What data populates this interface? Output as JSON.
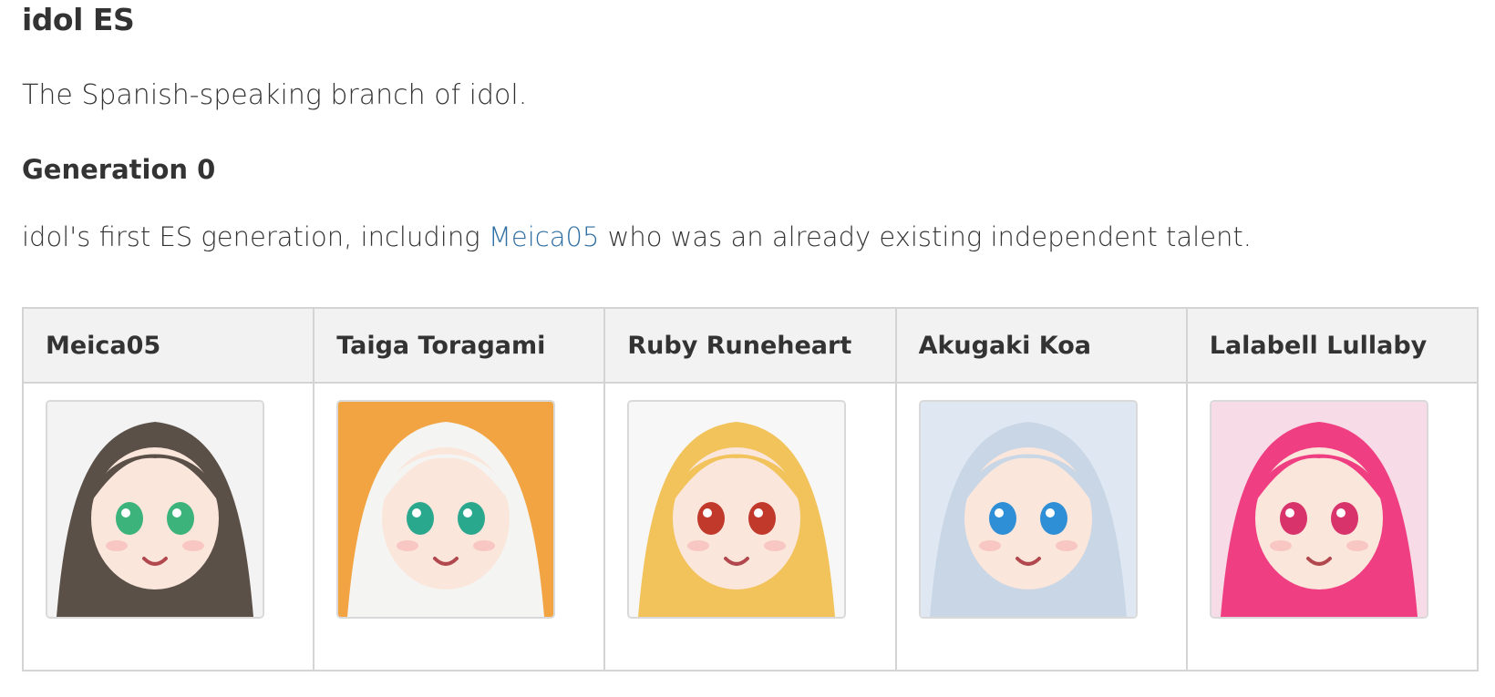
{
  "branch": {
    "title": "idol ES",
    "description": "The Spanish-speaking branch of idol."
  },
  "generation": {
    "heading": "Generation 0",
    "description_before": "idol's first ES generation, including ",
    "description_link": "Meica05",
    "description_after": " who was an already existing independent talent."
  },
  "talents": [
    {
      "name": "Meica05",
      "avatar_icon": "meica05-avatar",
      "bg_color": "#f3f3f3",
      "hair_color": "#5a5048",
      "eye_color": "#3bb37a"
    },
    {
      "name": "Taiga Toragami",
      "avatar_icon": "taiga-toragami-avatar",
      "bg_color": "#f2a443",
      "hair_color": "#f4f4f2",
      "eye_color": "#2aa88e"
    },
    {
      "name": "Ruby Runeheart",
      "avatar_icon": "ruby-runeheart-avatar",
      "bg_color": "#f7f7f7",
      "hair_color": "#f2c35a",
      "eye_color": "#c0392b"
    },
    {
      "name": "Akugaki Koa",
      "avatar_icon": "akugaki-koa-avatar",
      "bg_color": "#dfe8f2",
      "hair_color": "#c8d6e6",
      "eye_color": "#2f8fd6"
    },
    {
      "name": "Lalabell Lullaby",
      "avatar_icon": "lalabell-lullaby-avatar",
      "bg_color": "#f7dbe6",
      "hair_color": "#ef3f82",
      "eye_color": "#d8336b"
    }
  ]
}
